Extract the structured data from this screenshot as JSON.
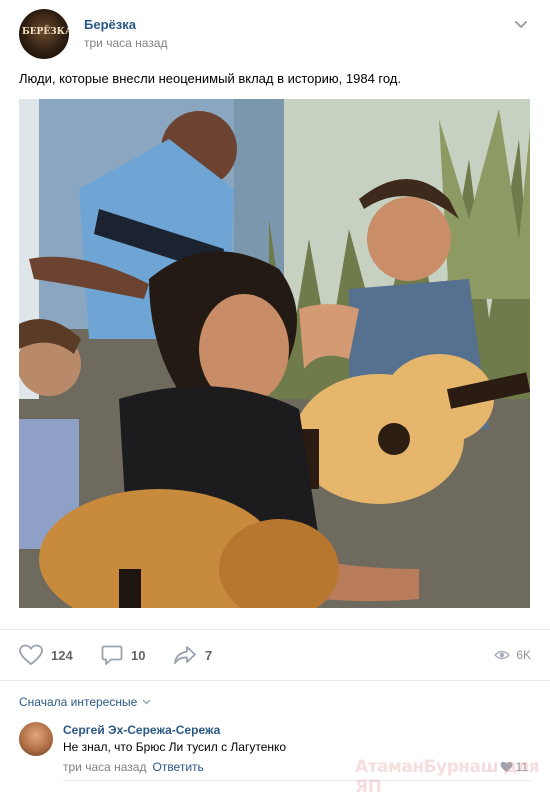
{
  "post": {
    "group_name": "Берёзка",
    "avatar_text": "БЕРЁЗКА",
    "time": "три часа назад",
    "text": "Люди, которые внесли неоценимый вклад в историю, 1984 год."
  },
  "actions": {
    "likes": "124",
    "comments": "10",
    "shares": "7",
    "views": "6K"
  },
  "comments_section": {
    "sort_label": "Сначала интересные",
    "comment": {
      "author": "Сергей Эх-Сережа-Сережа",
      "text": "Не знал, что Брюс Ли тусил с Лагутенко",
      "time": "три часа назад",
      "reply_label": "Ответить",
      "likes": "11"
    }
  },
  "watermark": "АтаманБурнаш  для ЯП",
  "colors": {
    "link": "#2a5885",
    "meta": "#828282",
    "icon": "#99a2ad"
  }
}
